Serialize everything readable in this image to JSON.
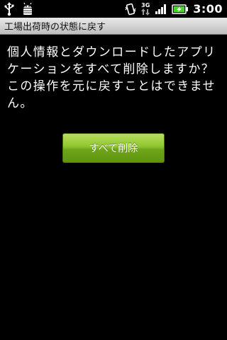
{
  "status_bar": {
    "left_icons": [
      "usb-icon",
      "android-debug-icon"
    ],
    "right_icons": [
      "vibrate-icon",
      "3g-data-icon",
      "signal-icon",
      "battery-charging-icon"
    ],
    "network_type": "3G",
    "time": "3:00",
    "battery_color": "#4fd32a"
  },
  "title_bar": {
    "title": "工場出荷時の状態に戻す"
  },
  "message": {
    "text": "個人情報とダウンロードしたアプリケーションをすべて削除しますか？この操作を元に戻すことはできません。"
  },
  "actions": {
    "erase_all_label": "すべて削除",
    "accent_color": "#8ec52e"
  }
}
